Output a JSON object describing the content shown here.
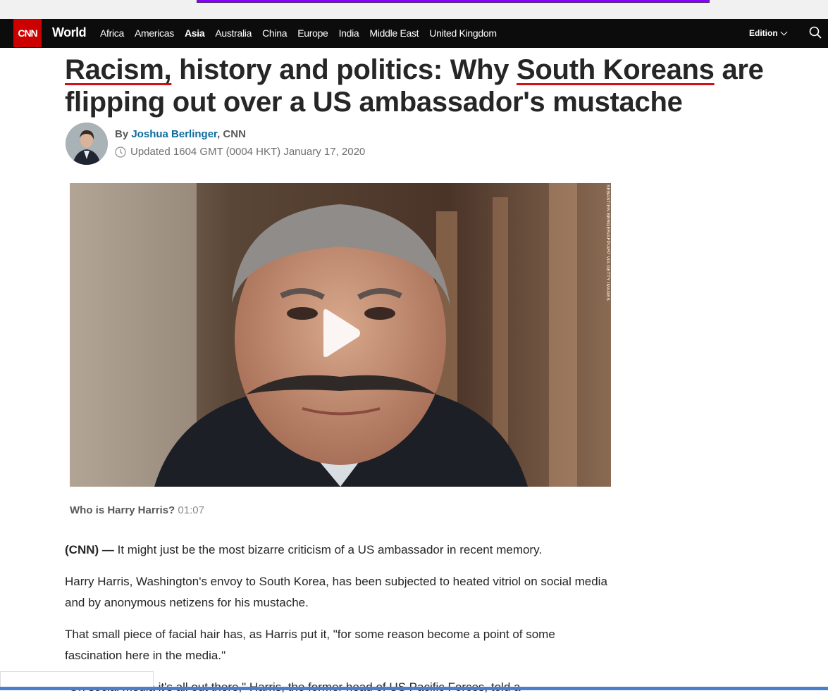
{
  "nav": {
    "logo": "CNN",
    "section": "World",
    "links": [
      "Africa",
      "Americas",
      "Asia",
      "Australia",
      "China",
      "Europe",
      "India",
      "Middle East",
      "United Kingdom"
    ],
    "active_link": "Asia",
    "edition_label": "Edition"
  },
  "article": {
    "headline": {
      "part1": "Racism,",
      "part2": " history and politics: Why ",
      "part3": "South Koreans",
      "part4": " are flipping out over a US ambassador's mustache"
    },
    "byline_prefix": "By ",
    "author": "Joshua Berlinger",
    "outlet": ", CNN",
    "updated": "Updated 1604 GMT (0004 HKT) January 17, 2020",
    "video": {
      "credit": "SEBASTIEN BERGER/AFP/AFP VIA GETTY IMAGES",
      "caption_title": "Who is Harry Harris?",
      "duration": "01:07"
    },
    "paragraphs": [
      {
        "lead": "(CNN) — ",
        "text": "It might just be the most bizarre criticism of a US ambassador in recent memory."
      },
      {
        "lead": "",
        "text": "Harry Harris, Washington's envoy to South Korea, has been subjected to heated vitriol on social media and by anonymous netizens for his mustache."
      },
      {
        "lead": "",
        "text": "That small piece of facial hair has, as Harris put it, \"for some reason become a point of some fascination here in the media.\""
      },
      {
        "lead": "",
        "text": "\"On social media it's all out there,\" Harris, the former head of US Pacific Forces, told a"
      }
    ]
  },
  "colors": {
    "nav_bg": "#0c0c0c",
    "brand_red": "#cc0000",
    "author_link": "#0c6c9c",
    "spellcheck_underline": "#d0111b"
  }
}
